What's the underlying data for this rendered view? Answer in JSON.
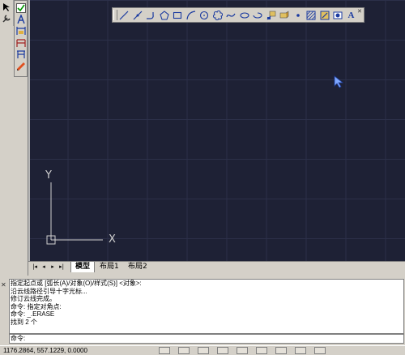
{
  "left_toolbar": {
    "icons": [
      "pointer-icon",
      "checkmark-icon",
      "text-style-icon",
      "dim-style-icon",
      "table-style-icon",
      "plot-style-icon",
      "pencil-icon"
    ]
  },
  "draw_toolbar": {
    "tools": [
      "line-icon",
      "construction-line-icon",
      "polyline-icon",
      "polygon-icon",
      "rectangle-icon",
      "arc-icon",
      "circle-icon",
      "revision-cloud-icon",
      "spline-icon",
      "ellipse-icon",
      "ellipse-arc-icon",
      "insert-block-icon",
      "make-block-icon",
      "point-icon",
      "hatch-icon",
      "gradient-icon",
      "region-icon",
      "multiline-text-icon"
    ],
    "text_tool_label": "A"
  },
  "canvas": {
    "background": "#1e2135",
    "grid_color": "#2c3049",
    "ucs_y_label": "Y",
    "ucs_x_label": "X",
    "ucs_color": "#d0d0d0"
  },
  "tabs": {
    "items": [
      {
        "label": "模型",
        "active": true
      },
      {
        "label": "布局1",
        "active": false
      },
      {
        "label": "布局2",
        "active": false
      }
    ]
  },
  "command": {
    "history": [
      "指定起点或 [弧长(A)/对象(O)/样式(S)] <对象>:",
      "沿云线路径引导十字光标...",
      "修订云线完成。",
      "命令: 指定对角点:",
      "命令: _.ERASE",
      "找到 2 个"
    ],
    "prompt": "命令:"
  },
  "status": {
    "coordinates": "1176.2864, 557.1229, 0.0000"
  }
}
